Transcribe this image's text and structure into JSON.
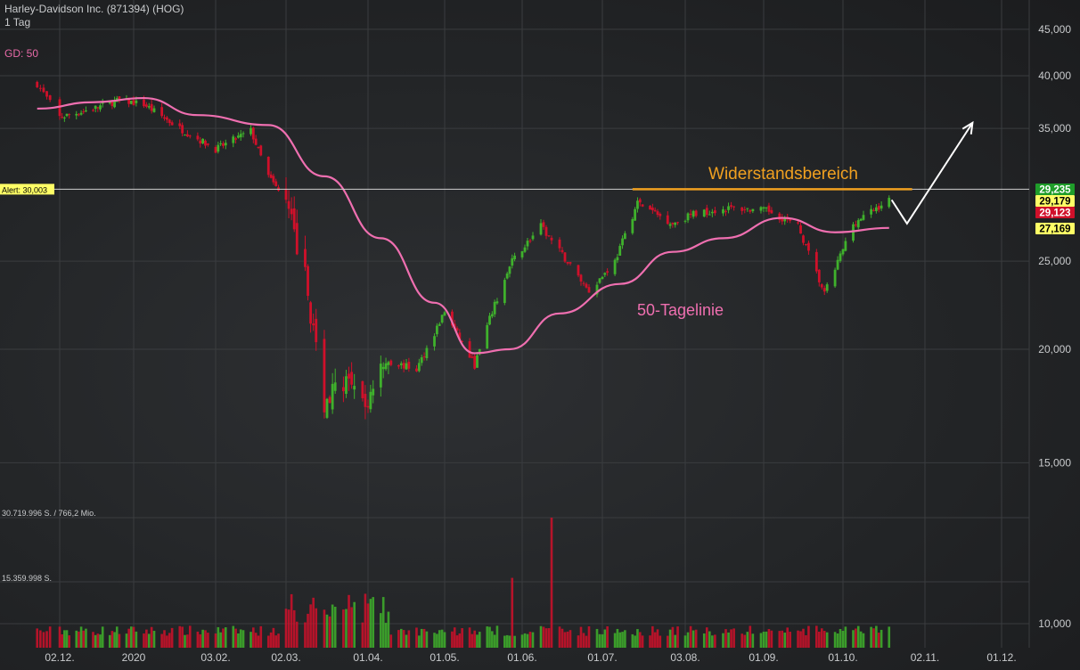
{
  "header": {
    "title": "Harley-Davidson Inc. (871394) (HOG)",
    "period": "1 Tag",
    "indicator": "GD: 50"
  },
  "annotations": {
    "resistance_label": "Widerstandsbereich",
    "ma_label": "50-Tagelinie",
    "alert_label": "Alert: 30,003"
  },
  "price_tags": [
    {
      "text": "29,235",
      "bg": "#1f9d2a",
      "fg": "#ffffff",
      "value": 29.235
    },
    {
      "text": "29,179",
      "bg": "#ffff66",
      "fg": "#000000",
      "value": 29.179
    },
    {
      "text": "29,123",
      "bg": "#d0102a",
      "fg": "#ffffff",
      "value": 29.123
    },
    {
      "text": "27,169",
      "bg": "#ffff66",
      "fg": "#000000",
      "value": 27.169
    }
  ],
  "volume_labels": [
    "30.719.996 S. / 766,2 Mio.",
    "15.359.998 S."
  ],
  "colors": {
    "up": "#3fb12c",
    "down": "#d0102a",
    "ma": "#ef6fb0",
    "resistance": "#f0a020",
    "alert_line": "#cfcfcf",
    "arrow": "#ffffff"
  },
  "chart_data": {
    "type": "candlestick",
    "title": "Harley-Davidson Inc. (871394) (HOG)",
    "interval": "1 Tag",
    "scale": "log",
    "y_ticks": [
      {
        "value": 45,
        "label": "45,000"
      },
      {
        "value": 40,
        "label": "40,000"
      },
      {
        "value": 35,
        "label": "35,000"
      },
      {
        "value": 25,
        "label": "25,000"
      },
      {
        "value": 20,
        "label": "20,000"
      },
      {
        "value": 15,
        "label": "15,000"
      },
      {
        "value": 10,
        "label": "10,000"
      }
    ],
    "ylim": [
      10,
      45
    ],
    "x_ticks": [
      "02.12.",
      "2020",
      "03.02.",
      "02.03.",
      "01.04.",
      "01.05.",
      "01.06.",
      "01.07.",
      "03.08.",
      "01.09.",
      "01.10.",
      "02.11.",
      "01.12."
    ],
    "close_trajectory": [
      {
        "date": "2019-11-25",
        "close": 39.2
      },
      {
        "date": "2019-12-02",
        "close": 36.0
      },
      {
        "date": "2019-12-16",
        "close": 36.8
      },
      {
        "date": "2019-12-27",
        "close": 37.6
      },
      {
        "date": "2020-01-06",
        "close": 37.2
      },
      {
        "date": "2020-01-20",
        "close": 35.0
      },
      {
        "date": "2020-02-03",
        "close": 33.2
      },
      {
        "date": "2020-02-17",
        "close": 34.8
      },
      {
        "date": "2020-02-24",
        "close": 31.0
      },
      {
        "date": "2020-03-02",
        "close": 29.0
      },
      {
        "date": "2020-03-09",
        "close": 24.0
      },
      {
        "date": "2020-03-16",
        "close": 17.5
      },
      {
        "date": "2020-03-23",
        "close": 18.5
      },
      {
        "date": "2020-03-31",
        "close": 17.2
      },
      {
        "date": "2020-04-06",
        "close": 19.5
      },
      {
        "date": "2020-04-20",
        "close": 19.0
      },
      {
        "date": "2020-05-01",
        "close": 22.0
      },
      {
        "date": "2020-05-13",
        "close": 19.2
      },
      {
        "date": "2020-05-20",
        "close": 22.0
      },
      {
        "date": "2020-05-28",
        "close": 25.0
      },
      {
        "date": "2020-06-08",
        "close": 27.3
      },
      {
        "date": "2020-06-26",
        "close": 23.2
      },
      {
        "date": "2020-07-06",
        "close": 25.0
      },
      {
        "date": "2020-07-15",
        "close": 29.0
      },
      {
        "date": "2020-07-29",
        "close": 27.5
      },
      {
        "date": "2020-08-06",
        "close": 28.2
      },
      {
        "date": "2020-08-20",
        "close": 28.6
      },
      {
        "date": "2020-09-03",
        "close": 28.4
      },
      {
        "date": "2020-09-14",
        "close": 27.3
      },
      {
        "date": "2020-09-24",
        "close": 23.0
      },
      {
        "date": "2020-10-05",
        "close": 27.5
      },
      {
        "date": "2020-10-19",
        "close": 29.2
      }
    ],
    "ma50": [
      {
        "date": "2019-11-25",
        "value": 36.8
      },
      {
        "date": "2019-12-16",
        "value": 37.4
      },
      {
        "date": "2020-01-06",
        "value": 37.8
      },
      {
        "date": "2020-01-27",
        "value": 36.2
      },
      {
        "date": "2020-02-24",
        "value": 35.3
      },
      {
        "date": "2020-03-16",
        "value": 31.0
      },
      {
        "date": "2020-04-06",
        "value": 26.5
      },
      {
        "date": "2020-04-27",
        "value": 22.5
      },
      {
        "date": "2020-05-13",
        "value": 19.8
      },
      {
        "date": "2020-05-27",
        "value": 20.0
      },
      {
        "date": "2020-06-15",
        "value": 21.9
      },
      {
        "date": "2020-07-08",
        "value": 23.6
      },
      {
        "date": "2020-07-29",
        "value": 25.6
      },
      {
        "date": "2020-08-17",
        "value": 26.5
      },
      {
        "date": "2020-09-08",
        "value": 27.9
      },
      {
        "date": "2020-09-28",
        "value": 26.9
      },
      {
        "date": "2020-10-19",
        "value": 27.2
      }
    ],
    "resistance_level": 30.0,
    "alert_level": 30.003,
    "volume_max": 30719996,
    "volume_mid": 15359998,
    "volume_spikes": [
      {
        "date": "2020-06-12",
        "volume": 30719996,
        "direction": "down"
      },
      {
        "date": "2020-05-28",
        "volume": 16500000,
        "direction": "down"
      }
    ],
    "projection": {
      "pullback": 27.5,
      "target": 35.5
    }
  }
}
